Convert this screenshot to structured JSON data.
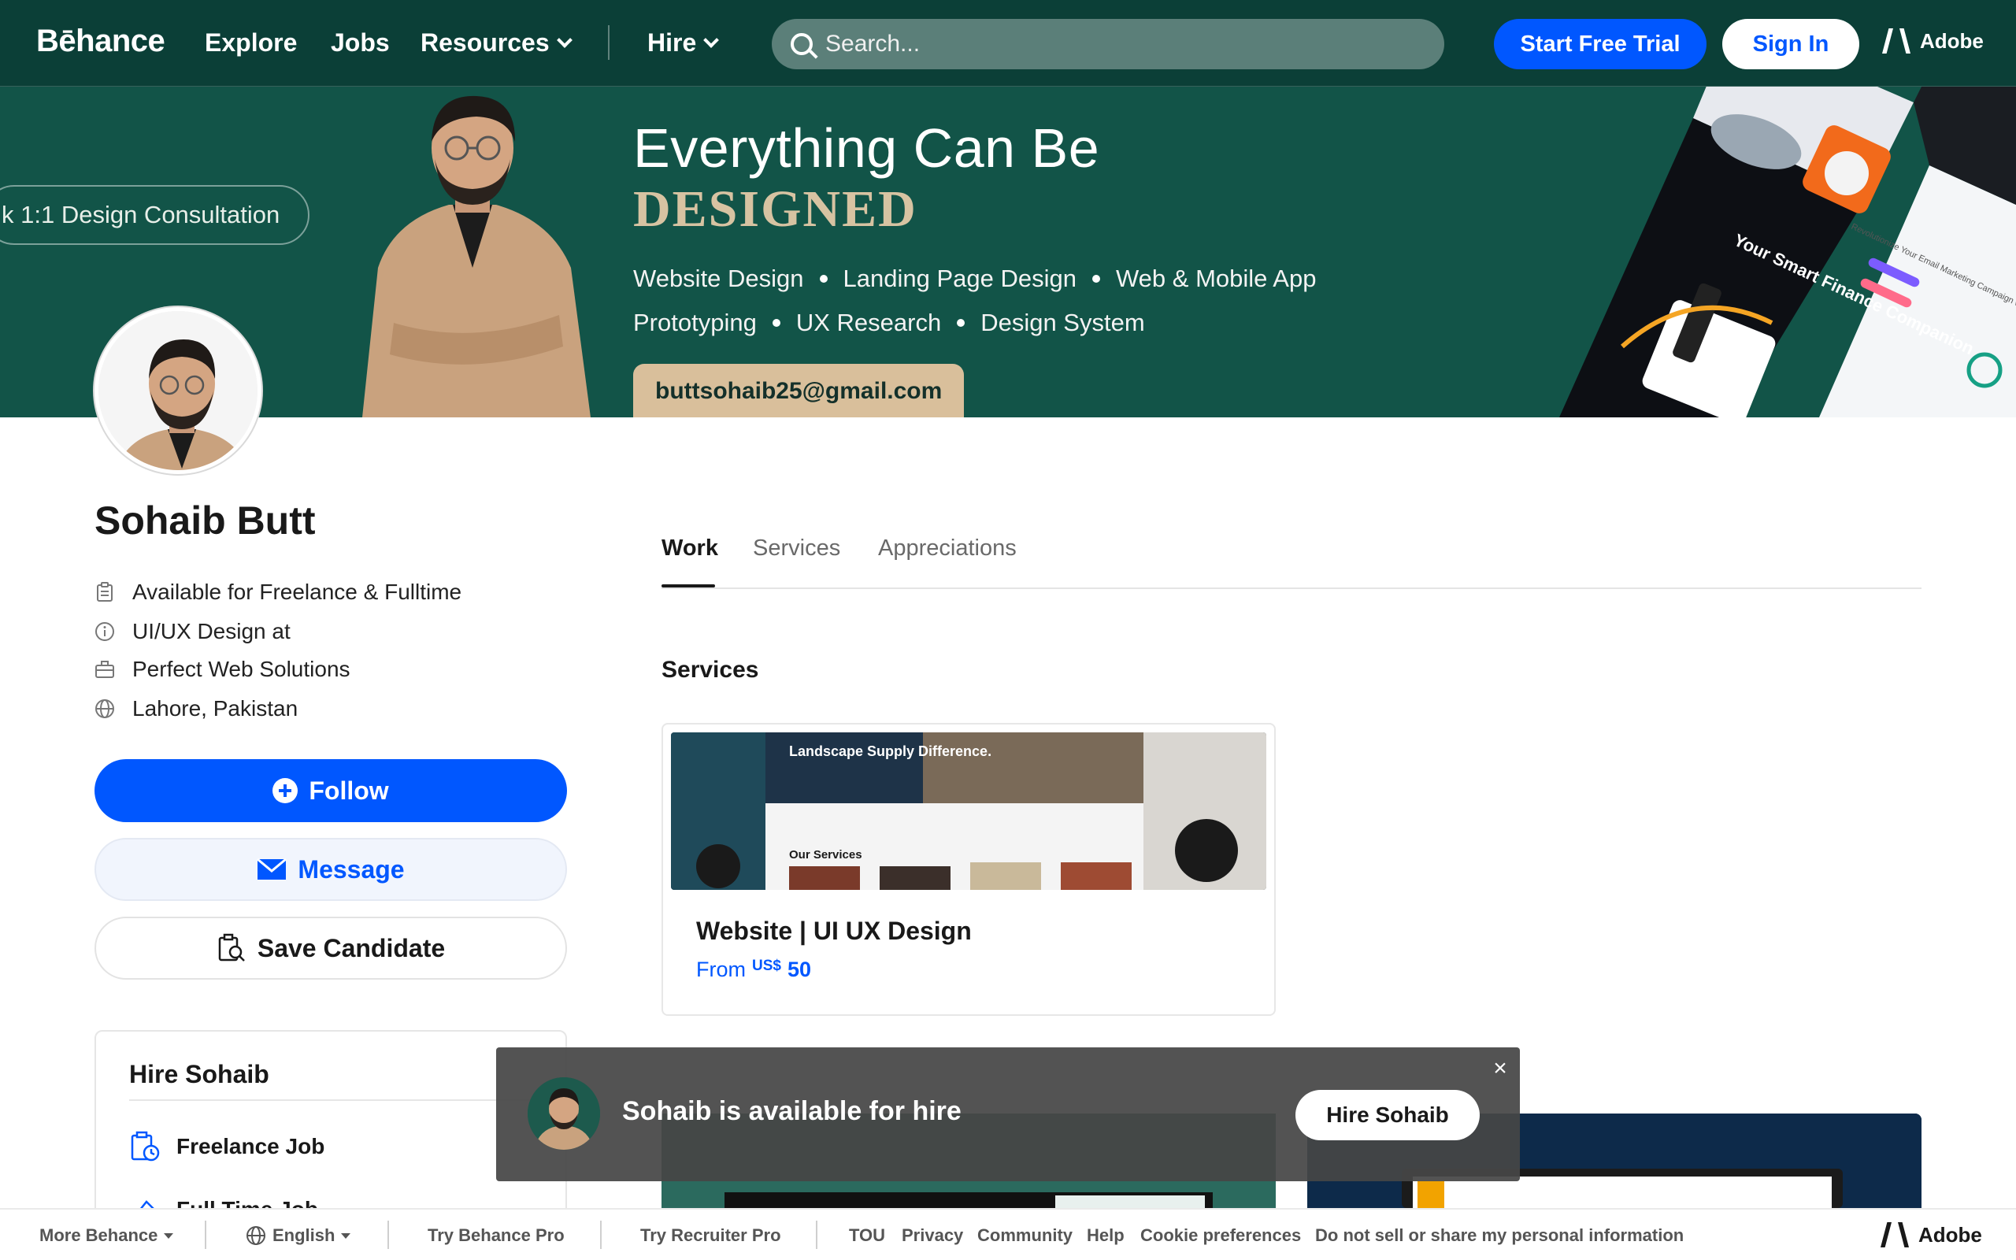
{
  "nav": {
    "brand": "Bēhance",
    "links": [
      "Explore",
      "Jobs",
      "Resources",
      "Hire"
    ],
    "search_placeholder": "Search...",
    "start_trial": "Start Free Trial",
    "sign_in": "Sign In",
    "adobe": "Adobe"
  },
  "banner": {
    "consult_pill": "k 1:1 Design Consultation",
    "headline": "Everything Can Be",
    "headline_accent": "DESIGNED",
    "line1": [
      "Website Design",
      "Landing Page Design",
      "Web & Mobile App"
    ],
    "line2": [
      "Prototyping",
      "UX Research",
      "Design System"
    ],
    "email": "buttsohaib25@gmail.com",
    "mock_texts": [
      "Your Smart Finance Companion",
      "Revolutionize Your Email Marketing Campaign with Global Benefits"
    ]
  },
  "profile": {
    "name": "Sohaib Butt",
    "availability": "Available for Freelance & Fulltime",
    "role": "UI/UX Design at",
    "company": "Perfect Web Solutions",
    "location": "Lahore, Pakistan",
    "follow": "Follow",
    "message": "Message",
    "save": "Save Candidate"
  },
  "hire_card": {
    "title": "Hire Sohaib",
    "options": [
      "Freelance Job",
      "Full Time Job"
    ]
  },
  "tabs": [
    "Work",
    "Services",
    "Appreciations"
  ],
  "services": {
    "section_title": "Services",
    "card": {
      "title": "Website | UI UX Design",
      "from": "From",
      "currency": "US$",
      "amount": "50",
      "thumb_text1": "Landscape Supply Difference.",
      "thumb_text2": "Our Services"
    }
  },
  "toast": {
    "text": "Sohaib is available for hire",
    "button": "Hire Sohaib",
    "close": "×"
  },
  "footer": {
    "more": "More Behance",
    "language": "English",
    "behance_pro": "Try Behance Pro",
    "recruiter_pro": "Try Recruiter Pro",
    "links": [
      "TOU",
      "Privacy",
      "Community",
      "Help",
      "Cookie preferences",
      "Do not sell or share my personal information"
    ],
    "adobe": "Adobe"
  },
  "colors": {
    "nav_bg": "#0b3f37",
    "banner_bg": "#125448",
    "accent_blue": "#0057ff",
    "banner_gold": "#d7c3a2"
  }
}
